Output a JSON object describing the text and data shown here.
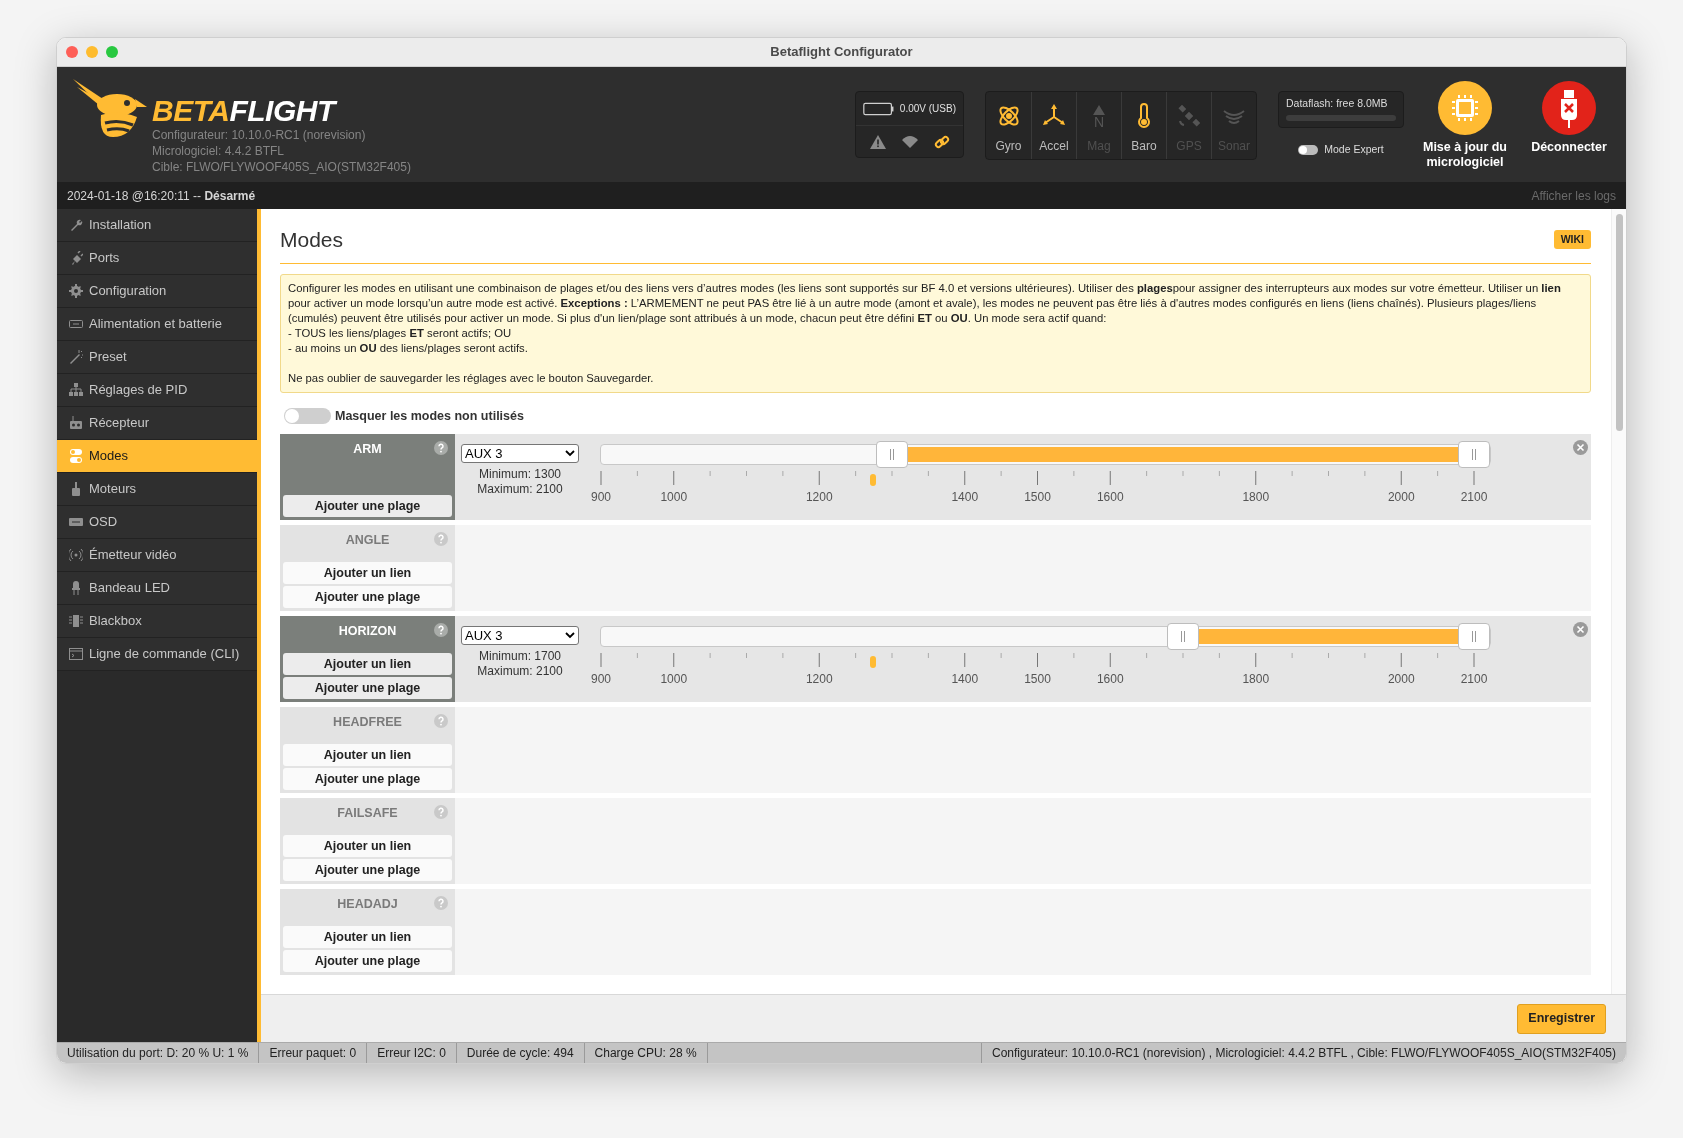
{
  "window": {
    "title": "Betaflight Configurator"
  },
  "header": {
    "wordmark": {
      "prefix": "BETA",
      "suffix": "FLIGHT"
    },
    "versions": [
      "Configurateur: 10.10.0-RC1 (norevision)",
      "Micrologiciel: 4.4.2 BTFL",
      "Cible: FLWO/FLYWOOF405S_AIO(STM32F405)"
    ],
    "battery": {
      "reading": "0.00V (USB)",
      "indicators": [
        {
          "kind": "warning",
          "on": false
        },
        {
          "kind": "parachute",
          "on": false
        },
        {
          "kind": "link",
          "on": true
        }
      ]
    },
    "sensors": [
      {
        "kind": "gyro",
        "label": "Gyro",
        "on": true
      },
      {
        "kind": "accel",
        "label": "Accel",
        "on": true
      },
      {
        "kind": "mag",
        "label": "Mag",
        "on": false,
        "glyph": "N"
      },
      {
        "kind": "baro",
        "label": "Baro",
        "on": true
      },
      {
        "kind": "gps",
        "label": "GPS",
        "on": false
      },
      {
        "kind": "sonar",
        "label": "Sonar",
        "on": false
      }
    ],
    "dataflash": {
      "label": "Dataflash: free 8.0MB",
      "level": 0
    },
    "expert_mode": {
      "label": "Mode Expert",
      "on": false
    },
    "buttons": [
      {
        "kind": "update",
        "label": "Mise à jour du micrologiciel"
      },
      {
        "kind": "disconnect",
        "label": "Déconnecter"
      }
    ]
  },
  "status_line": {
    "text": "2024-01-18 @16:20:11 -- **Désarmé**",
    "logs_link": "Afficher les logs"
  },
  "sidebar": {
    "items": [
      {
        "label": "Installation",
        "selected": false
      },
      {
        "label": "Ports",
        "selected": false
      },
      {
        "label": "Configuration",
        "selected": false
      },
      {
        "label": "Alimentation et batterie",
        "selected": false
      },
      {
        "label": "Preset",
        "selected": false
      },
      {
        "label": "Réglages de PID",
        "selected": false
      },
      {
        "label": "Récepteur",
        "selected": false
      },
      {
        "label": "Modes",
        "selected": true
      },
      {
        "label": "Moteurs",
        "selected": false
      },
      {
        "label": "OSD",
        "selected": false
      },
      {
        "label": "Émetteur vidéo",
        "selected": false
      },
      {
        "label": "Bandeau LED",
        "selected": false
      },
      {
        "label": "Blackbox",
        "selected": false
      },
      {
        "label": "Ligne de commande (CLI)",
        "selected": false
      }
    ]
  },
  "content": {
    "title": "Modes",
    "wiki_button": "WIKI",
    "info": {
      "intro": "Configurer les modes en utilisant une combinaison de plages et/ou des liens vers d’autres modes (les liens sont supportés sur BF 4.0 et versions ultérieures). Utiliser des **plages**pour assigner des interrupteurs aux modes sur votre émetteur. Utiliser un **lien** pour activer un mode lorsqu’un autre mode est activé. **Exceptions :** L’ARMEMENT ne peut PAS être lié à un autre mode (amont et avale), les modes ne peuvent pas être liés à d'autres modes configurés en liens (liens chaînés). Plusieurs plages/liens (cumulés) peuvent être utilisés pour activer un mode. Si plus d'un lien/plage sont attribués à un mode, chacun peut être défini **ET** ou **OU**. Un mode sera actif quand:",
      "conditions": [
        "- TOUS les liens/plages **ET** seront actifs; OU",
        "- au moins un **OU** des liens/plages seront actifs."
      ],
      "note": "Ne pas oublier de sauvegarder les réglages avec le bouton Sauvegarder."
    },
    "hide_unused": {
      "label": "Masquer les modes non utilisés",
      "on": false
    },
    "modes": [
      {
        "name": "ARM",
        "active": true,
        "buttons": [
          "Ajouter une plage"
        ],
        "range": {
          "channel": "AUX 3",
          "minimum": "Minimum: 1300",
          "maximum": "Maximum: 2100",
          "handles": [
            {
              "level": 0.333
            },
            {
              "level": 1
            }
          ],
          "indicator": {
            "level": 0.312
          },
          "scale": [
            "900",
            "1000",
            "1200",
            "1400",
            "1500",
            "1600",
            "1800",
            "2000",
            "2100"
          ]
        }
      },
      {
        "name": "ANGLE",
        "active": false,
        "buttons": [
          "Ajouter un lien",
          "Ajouter une plage"
        ]
      },
      {
        "name": "HORIZON",
        "active": true,
        "buttons": [
          "Ajouter un lien",
          "Ajouter une plage"
        ],
        "range": {
          "channel": "AUX 3",
          "minimum": "Minimum: 1700",
          "maximum": "Maximum: 2100",
          "handles": [
            {
              "level": 0.667
            },
            {
              "level": 1
            }
          ],
          "indicator": {
            "level": 0.312
          },
          "scale": [
            "900",
            "1000",
            "1200",
            "1400",
            "1500",
            "1600",
            "1800",
            "2000",
            "2100"
          ]
        }
      },
      {
        "name": "HEADFREE",
        "active": false,
        "buttons": [
          "Ajouter un lien",
          "Ajouter une plage"
        ]
      },
      {
        "name": "FAILSAFE",
        "active": false,
        "buttons": [
          "Ajouter un lien",
          "Ajouter une plage"
        ]
      },
      {
        "name": "HEADADJ",
        "active": false,
        "buttons": [
          "Ajouter un lien",
          "Ajouter une plage"
        ]
      }
    ],
    "save_button": "Enregistrer"
  },
  "status_bar": {
    "cells": [
      "Utilisation du port: D: 20 % U: 1 %",
      "Erreur paquet: 0",
      "Erreur I2C: 0",
      "Durée de cycle: 494",
      "Charge CPU: 28 %"
    ],
    "info": "Configurateur: 10.10.0-RC1 (norevision) , Micrologiciel: 4.4.2 BTFL , Cible: FLWO/FLYWOOF405S_AIO(STM32F405)"
  }
}
